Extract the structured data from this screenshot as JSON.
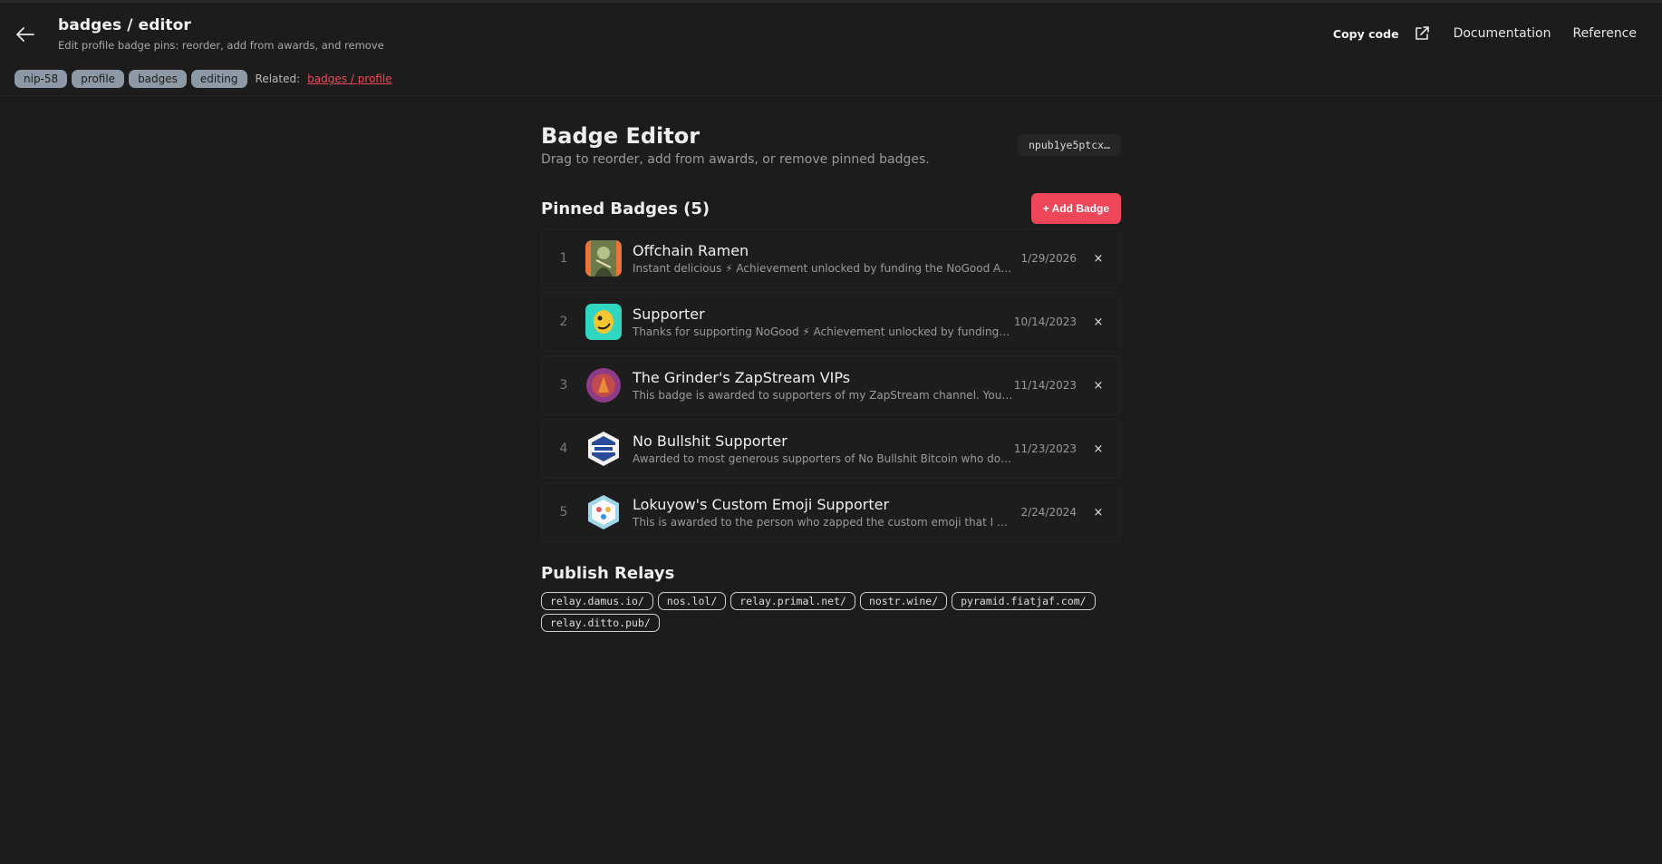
{
  "header": {
    "title": "badges / editor",
    "subtitle": "Edit profile badge pins: reorder, add from awards, and remove",
    "copy_code": "Copy code",
    "nav": [
      "Documentation",
      "Reference"
    ]
  },
  "tags": [
    "nip-58",
    "profile",
    "badges",
    "editing"
  ],
  "related": {
    "label": "Related:",
    "link": "badges / profile"
  },
  "editor": {
    "title": "Badge Editor",
    "description": "Drag to reorder, add from awards, or remove pinned badges.",
    "npub": "npub1ye5ptcx…"
  },
  "pinned": {
    "title": "Pinned Badges (5)",
    "add_label": "+ Add Badge",
    "remove_glyph": "×",
    "items": [
      {
        "num": "1",
        "name": "Offchain Ramen",
        "desc": "Instant delicious ⚡ Achievement unlocked by funding the NoGood Art Boo…",
        "date": "1/29/2026"
      },
      {
        "num": "2",
        "name": "Supporter",
        "desc": "Thanks for supporting NoGood ⚡ Achievement unlocked by funding NoG…",
        "date": "10/14/2023"
      },
      {
        "num": "3",
        "name": "The Grinder's ZapStream VIPs",
        "desc": "This badge is awarded to supporters of my ZapStream channel. You can't b…",
        "date": "11/14/2023"
      },
      {
        "num": "4",
        "name": "No Bullshit Supporter",
        "desc": "Awarded to most generous supporters of No Bullshit Bitcoin who donated…",
        "date": "11/23/2023"
      },
      {
        "num": "5",
        "name": "Lokuyow's Custom Emoji Supporter",
        "desc": "This is awarded to the person who zapped the custom emoji that I created. …",
        "date": "2/24/2024"
      }
    ]
  },
  "relays": {
    "title": "Publish Relays",
    "items": [
      "relay.damus.io/",
      "nos.lol/",
      "relay.primal.net/",
      "nostr.wine/",
      "pyramid.fiatjaf.com/",
      "relay.ditto.pub/"
    ]
  },
  "colors": {
    "accent": "#f0465a",
    "background": "#1c1c1c",
    "tag_bg": "#8d9aa6"
  }
}
